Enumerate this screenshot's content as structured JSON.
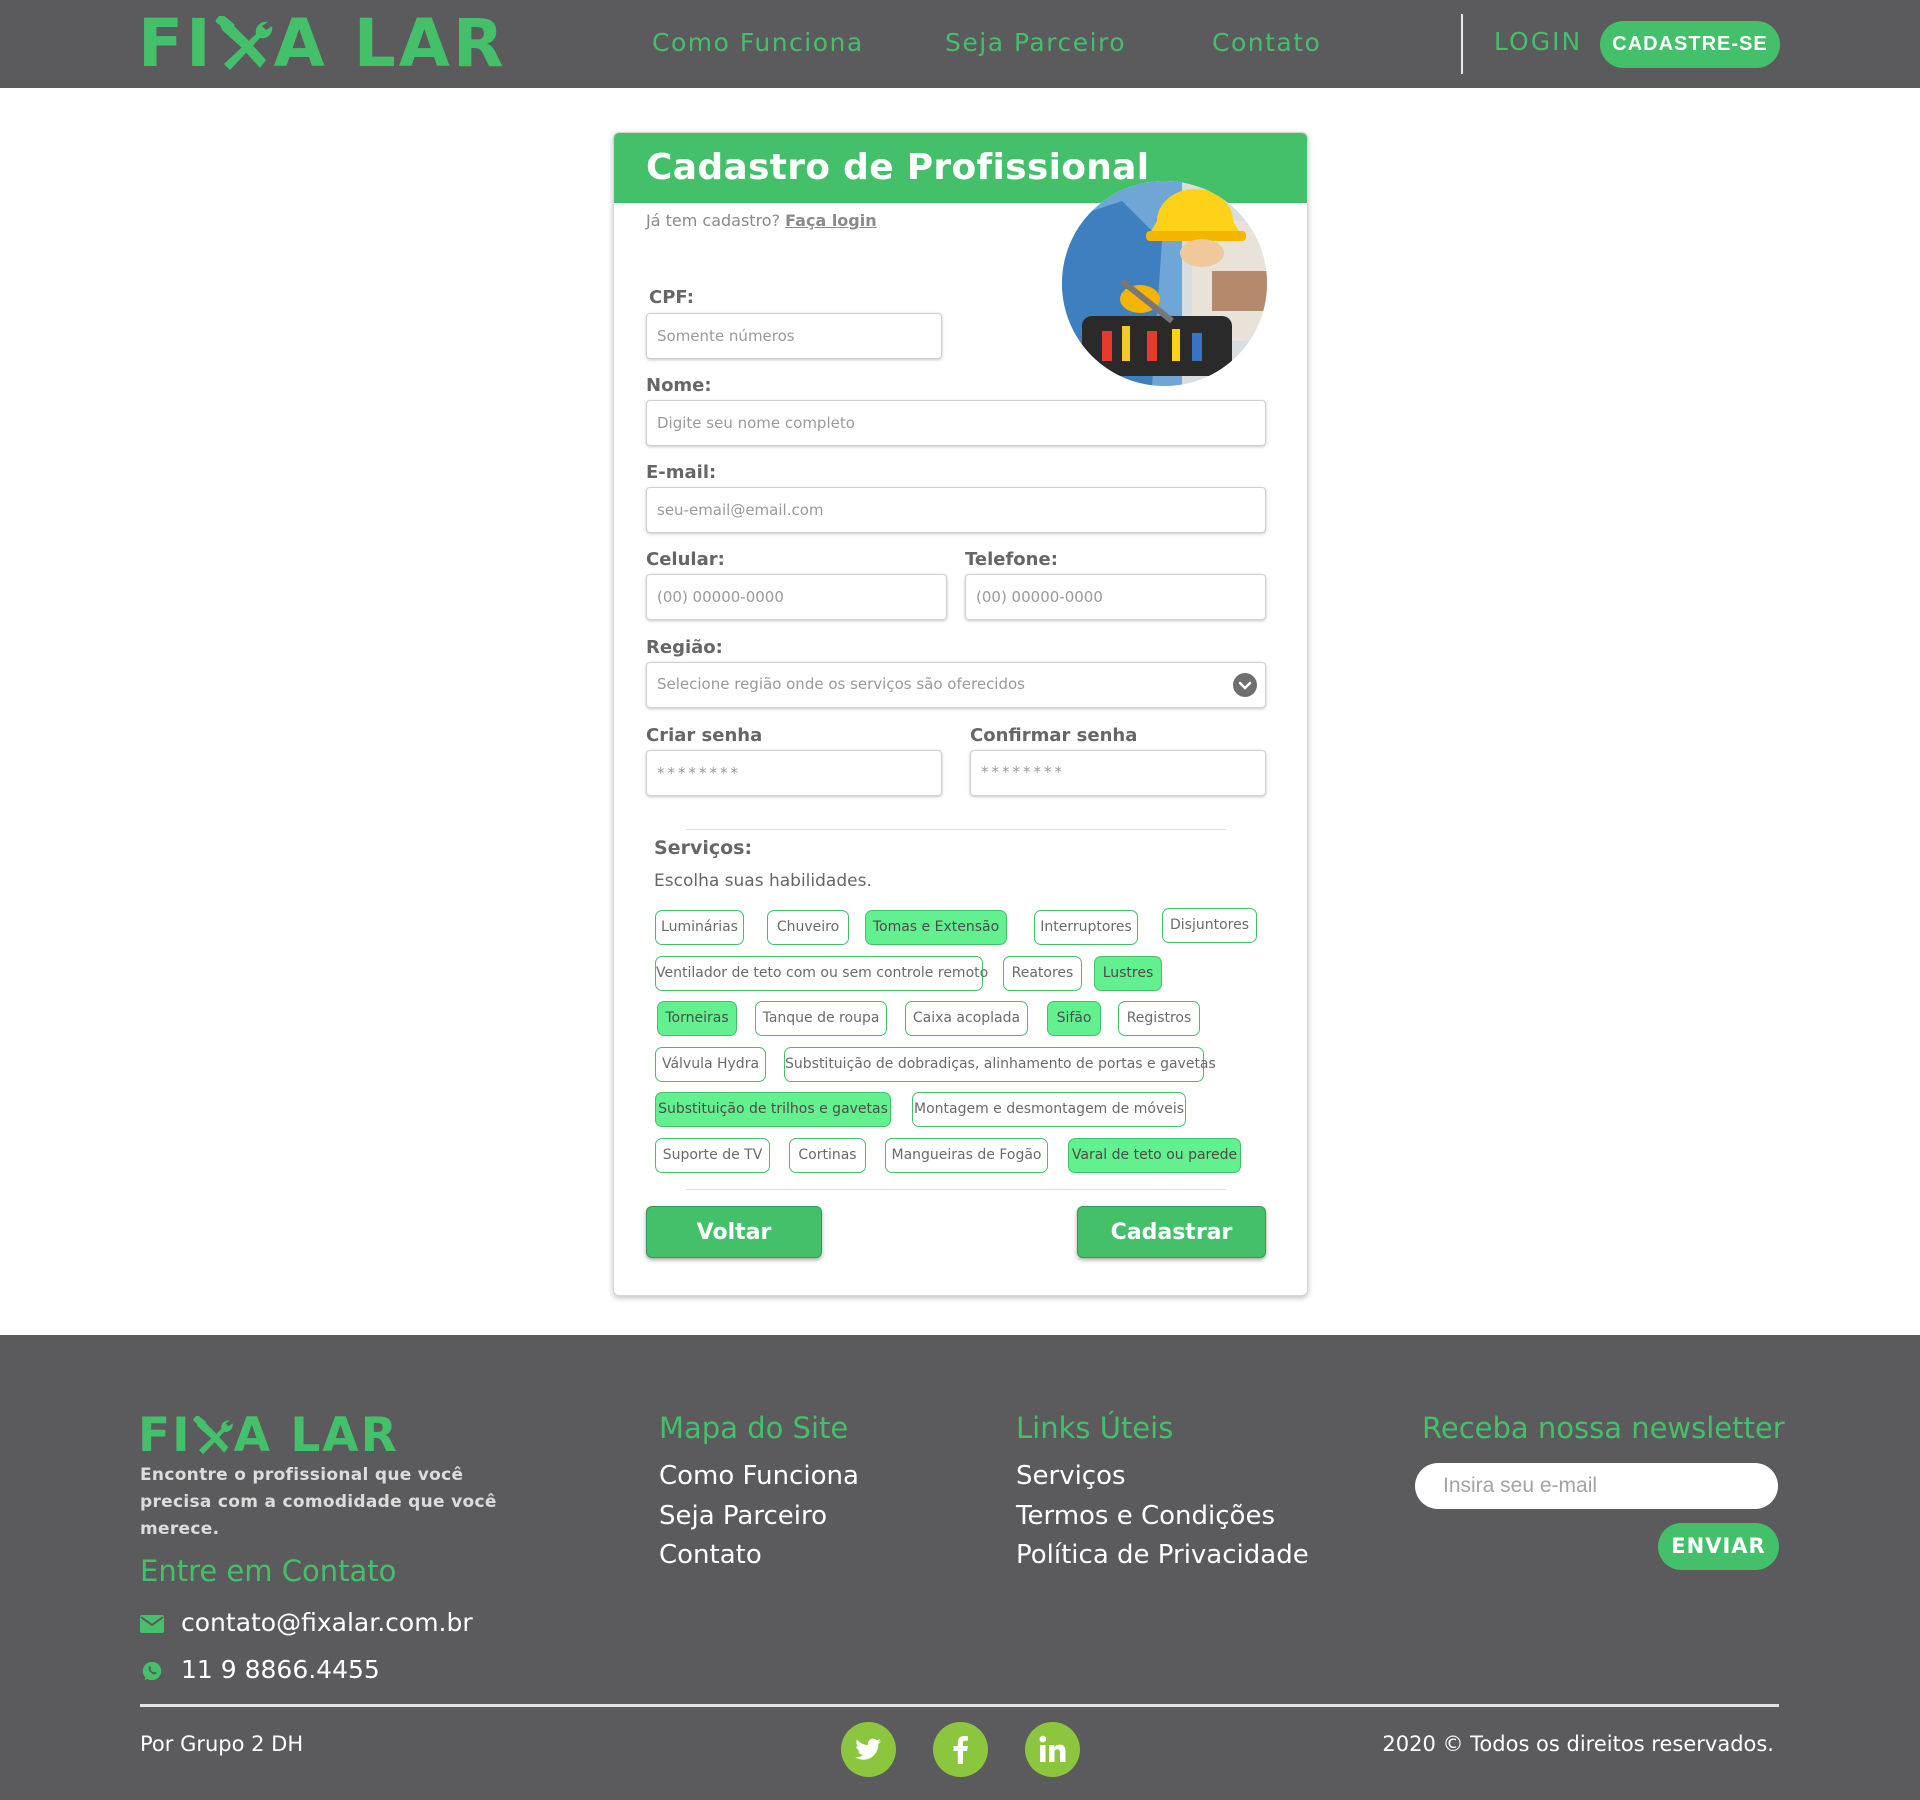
{
  "brand": {
    "logo_text": "FIXA LAR",
    "logo_prefix": "FI",
    "logo_suffix": "A LAR",
    "accent_color": "#45c06a",
    "bg_dark": "#5b5a5c"
  },
  "nav": {
    "items": [
      "Como Funciona",
      "Seja Parceiro",
      "Contato"
    ],
    "login": "LOGIN",
    "signup": "CADASTRE-SE"
  },
  "form": {
    "title": "Cadastro de Profissional",
    "already_text": "Já tem cadastro?",
    "login_link": "Faça login",
    "cpf": {
      "label": "CPF:",
      "placeholder": "Somente números"
    },
    "nome": {
      "label": "Nome:",
      "placeholder": "Digite seu nome completo"
    },
    "email": {
      "label": "E-mail:",
      "placeholder": "seu-email@email.com"
    },
    "celular": {
      "label": "Celular:",
      "placeholder": "(00) 00000-0000"
    },
    "telefone": {
      "label": "Telefone:",
      "placeholder": "(00) 00000-0000"
    },
    "regiao": {
      "label": "Região:",
      "placeholder": "Selecione região onde os serviços são oferecidos"
    },
    "senha": {
      "label": "Criar senha",
      "value": "********"
    },
    "confirmar": {
      "label": "Confirmar senha",
      "value": "********"
    },
    "services_title": "Serviços:",
    "services_subtitle": "Escolha suas habilidades.",
    "services": [
      {
        "label": "Luminárias",
        "selected": false
      },
      {
        "label": "Chuveiro",
        "selected": false
      },
      {
        "label": "Tomas e Extensão",
        "selected": true
      },
      {
        "label": "Interruptores",
        "selected": false
      },
      {
        "label": "Disjuntores",
        "selected": false
      },
      {
        "label": "Ventilador de teto com ou sem controle remoto",
        "selected": false
      },
      {
        "label": "Reatores",
        "selected": false
      },
      {
        "label": "Lustres",
        "selected": true
      },
      {
        "label": "Torneiras",
        "selected": true
      },
      {
        "label": "Tanque de roupa",
        "selected": false
      },
      {
        "label": "Caixa acoplada",
        "selected": false
      },
      {
        "label": "Sifão",
        "selected": true
      },
      {
        "label": "Registros",
        "selected": false
      },
      {
        "label": "Válvula Hydra",
        "selected": false
      },
      {
        "label": "Substituição de dobradiças, alinhamento de portas e gavetas",
        "selected": false
      },
      {
        "label": "Substituição de trilhos e gavetas",
        "selected": true
      },
      {
        "label": "Montagem e desmontagem de móveis",
        "selected": false
      },
      {
        "label": "Suporte de TV",
        "selected": false
      },
      {
        "label": "Cortinas",
        "selected": false
      },
      {
        "label": "Mangueiras de Fogão",
        "selected": false
      },
      {
        "label": "Varal de teto ou parede",
        "selected": true
      }
    ],
    "back_button": "Voltar",
    "submit_button": "Cadastrar"
  },
  "footer": {
    "tagline": "Encontre o profissional que você precisa com a comodidade que você merece.",
    "contact_title": "Entre em Contato",
    "email": "contato@fixalar.com.br",
    "phone": "11 9 8866.4455",
    "sitemap_title": "Mapa do Site",
    "sitemap_links": [
      "Como Funciona",
      "Seja Parceiro",
      "Contato"
    ],
    "useful_title": "Links Úteis",
    "useful_links": [
      "Serviços",
      "Termos e Condições",
      "Política de Privacidade"
    ],
    "newsletter_title": "Receba nossa newsletter",
    "newsletter_placeholder": "Insira seu e-mail",
    "newsletter_button": "ENVIAR",
    "credit": "Por Grupo 2 DH",
    "copyright": "2020 © Todos os direitos reservados.",
    "social_icons": [
      "twitter-icon",
      "facebook-icon",
      "linkedin-icon"
    ],
    "social_color": "#8cc63f"
  }
}
